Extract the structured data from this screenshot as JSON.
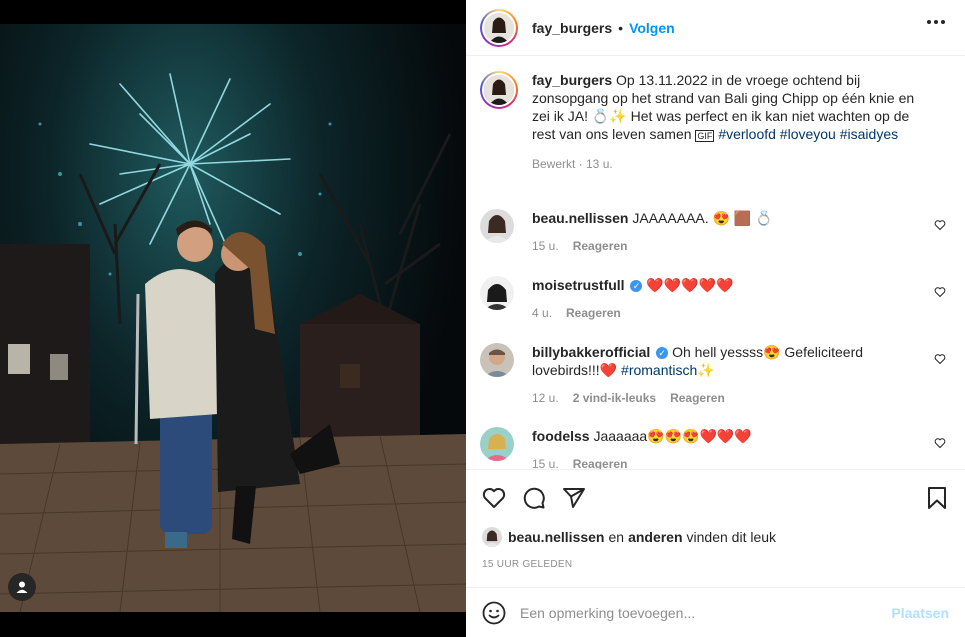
{
  "header": {
    "username": "fay_burgers",
    "separator": "•",
    "follow_label": "Volgen"
  },
  "caption": {
    "username": "fay_burgers",
    "text_part1": "Op 13.11.2022 in de vroege ochtend bij zonsopgang op het strand van Bali ging Chipp op één knie en zei ik JA! 💍✨ Het was perfect en ik kan niet wachten op de rest van ons leven samen",
    "hashtags": [
      "#verloofd",
      "#loveyou",
      "#isaidyes"
    ],
    "meta": "Bewerkt · 13 u."
  },
  "comments": [
    {
      "username": "beau.nellissen",
      "verified": false,
      "text": "JAAAAAAA. 😍 🟫 💍",
      "time": "15 u.",
      "likes": "",
      "reply": "Reageren"
    },
    {
      "username": "moisetrustfull",
      "verified": true,
      "text": "❤️❤️❤️❤️❤️",
      "time": "4 u.",
      "likes": "",
      "reply": "Reageren"
    },
    {
      "username": "billybakkerofficial",
      "verified": true,
      "text": "Oh hell yessss😍 Gefeliciteerd lovebirds!!!❤️",
      "hashtag": "#romantisch",
      "tail": "✨",
      "time": "12 u.",
      "likes": "2 vind-ik-leuks",
      "reply": "Reageren"
    },
    {
      "username": "foodelss",
      "verified": false,
      "text": "Jaaaaaa😍😍😍❤️❤️❤️",
      "time": "15 u.",
      "likes": "",
      "reply": "Reageren"
    }
  ],
  "likes": {
    "first_user": "beau.nellissen",
    "joiner": "en",
    "others": "anderen",
    "suffix": "vinden dit leuk"
  },
  "post_time": "15 UUR GELEDEN",
  "composer": {
    "placeholder": "Een opmerking toevoegen...",
    "post_label": "Plaatsen"
  },
  "colors": {
    "accent": "#0095f6",
    "hashtag": "#00376b",
    "muted": "#8e8e8e",
    "post_disabled": "#b2dffc"
  }
}
